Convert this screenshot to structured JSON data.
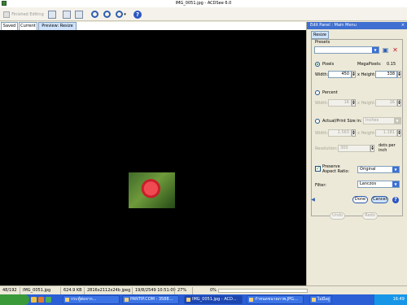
{
  "window": {
    "title": "IMG_0051.jpg - ACDSee 6.0"
  },
  "toolbar": {
    "finished_editing": "Finished Editing"
  },
  "tabs": [
    "Saved",
    "Current",
    "Preview: Resize"
  ],
  "panel": {
    "header": "Edit Panel : Main Menu",
    "close": "×",
    "tab": "Resize",
    "presets_label": "Presets",
    "pixels": {
      "label": "Pixels",
      "megapixels_label": "MegaPixels:",
      "megapixels_value": "0.15",
      "width_label": "Width:",
      "width_value": "450",
      "height_label": "x Height:",
      "height_value": "338"
    },
    "percent": {
      "label": "Percent",
      "width_label": "Width:",
      "width_value": "16",
      "height_label": "x Height:",
      "height_value": "16"
    },
    "actual": {
      "label": "Actual/Print Size in:",
      "unit": "Inches",
      "width_label": "Width:",
      "width_value": "1.563",
      "height_label": "x Height:",
      "height_value": "1.181"
    },
    "resolution": {
      "label": "Resolution:",
      "value": "300",
      "unit": "dots per inch"
    },
    "aspect": {
      "label": "Preserve Aspect Ratio:",
      "value": "Original",
      "checked": true
    },
    "filter": {
      "label": "Filter:",
      "value": "Lanczos"
    },
    "done": "Done",
    "cancel": "Cancel",
    "undo": "Undo",
    "redo": "Redo"
  },
  "status": {
    "index": "48/192",
    "filename": "IMG_0051.jpg",
    "size": "624.9 KB",
    "info": "2816x2112x24b jpeg",
    "date": "19/8/2549 10:51:09",
    "zoom": "27%",
    "progress": "0%",
    "progress_fraction": 0
  },
  "taskbar": {
    "tasks": [
      "กระทู้ต่อจาก...",
      "PANTIP.COM : 3588...",
      "IMG_0051.jpg - ACD...",
      "กำหนดขนาดภาพ.JPG..."
    ],
    "tray_label": "ไม่มีอยู่",
    "clock": "16:49"
  }
}
